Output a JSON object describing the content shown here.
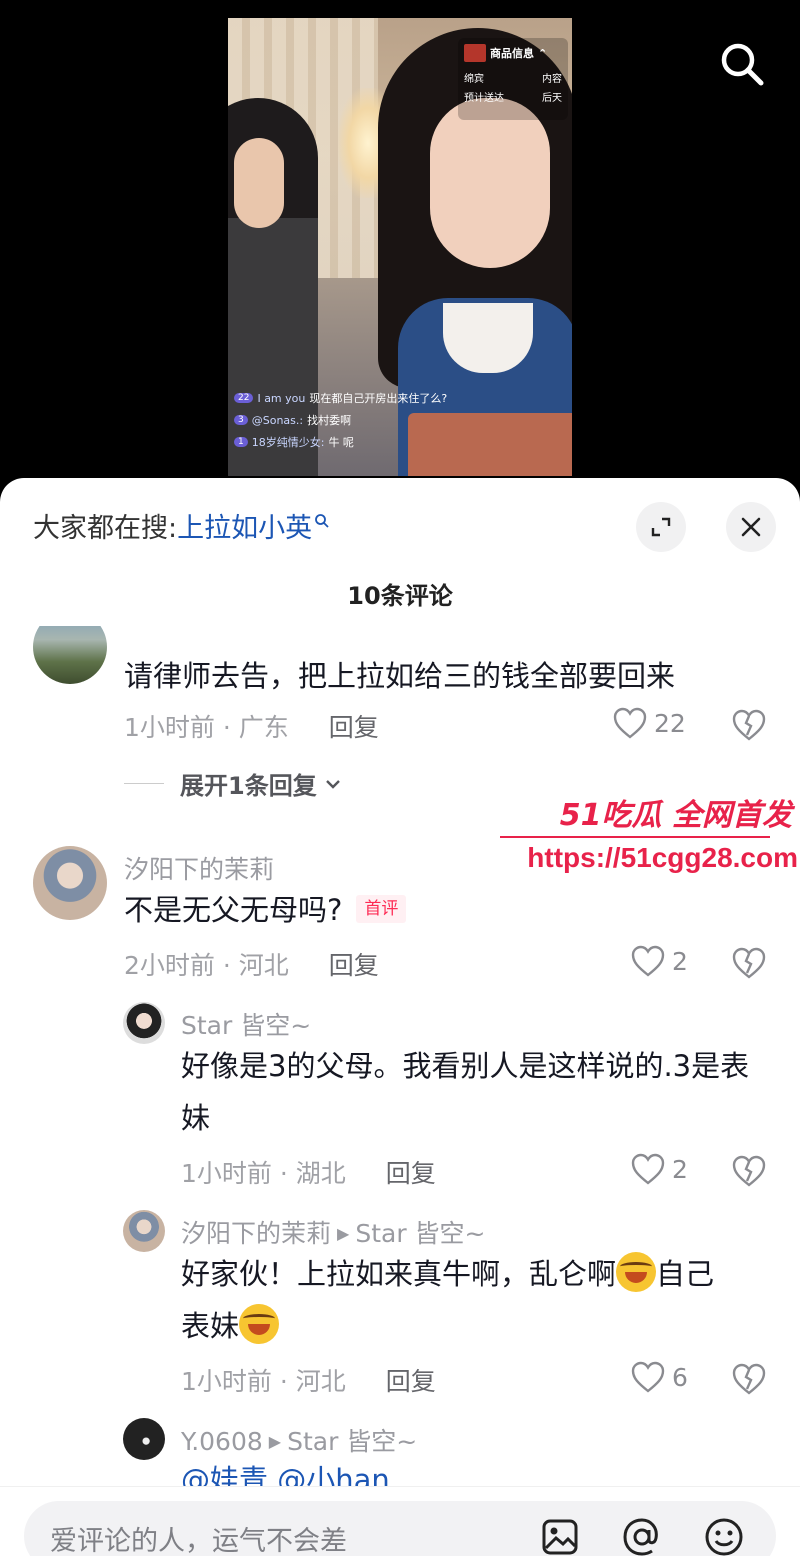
{
  "video": {
    "product_card": {
      "title": "商品信息",
      "row1_left": "绵宾",
      "row1_right": "内容",
      "row2_left": "预计送达",
      "row2_right": "后天"
    },
    "live_messages": [
      {
        "level": "22",
        "user": "I am you",
        "text": "现在都自己开房出来住了么?"
      },
      {
        "level": "3",
        "user": "@Sonas.:",
        "text": "找村委啊"
      },
      {
        "level": "1",
        "user": "18岁纯情少女:",
        "text": "牛 呢"
      }
    ]
  },
  "sheet": {
    "search_prefix": "大家都在搜:",
    "search_keyword": "上拉如小英",
    "comment_count": "10条评论"
  },
  "comments": [
    {
      "text": "请律师去告，把上拉如给三的钱全部要回来",
      "time_location": "1小时前 · 广东",
      "reply": "回复",
      "likes": "22",
      "expand": "展开1条回复"
    },
    {
      "nick": "汐阳下的茉莉",
      "text": "不是无父无母吗?",
      "tag": "首评",
      "time_location": "2小时前 · 河北",
      "reply": "回复",
      "likes": "2"
    },
    {
      "nick": "Star 皆空~",
      "text_line1": "好像是3的父母。我看别人是这样说的.3是表",
      "text_line2": "妹",
      "time_location": "1小时前 · 湖北",
      "reply": "回复",
      "likes": "2"
    },
    {
      "nick": "汐阳下的茉莉",
      "reply_to": "Star 皆空~",
      "text_part1": "好家伙！上拉如来真牛啊，乱仑啊",
      "text_part2": "自己",
      "text_part3": "表妹",
      "time_location": "1小时前 · 河北",
      "reply": "回复",
      "likes": "6"
    },
    {
      "nick": "Y.0608",
      "reply_to": "Star 皆空~",
      "text": "@娃青 @小han"
    }
  ],
  "watermark": {
    "title": "51吃瓜 全网首发",
    "url": "https://51cgg28.com"
  },
  "input": {
    "placeholder": "爱评论的人，运气不会差"
  },
  "colors": {
    "accent_red": "#fe2c55",
    "keyword_blue": "#1c56b4",
    "watermark_red": "#e8224a"
  }
}
